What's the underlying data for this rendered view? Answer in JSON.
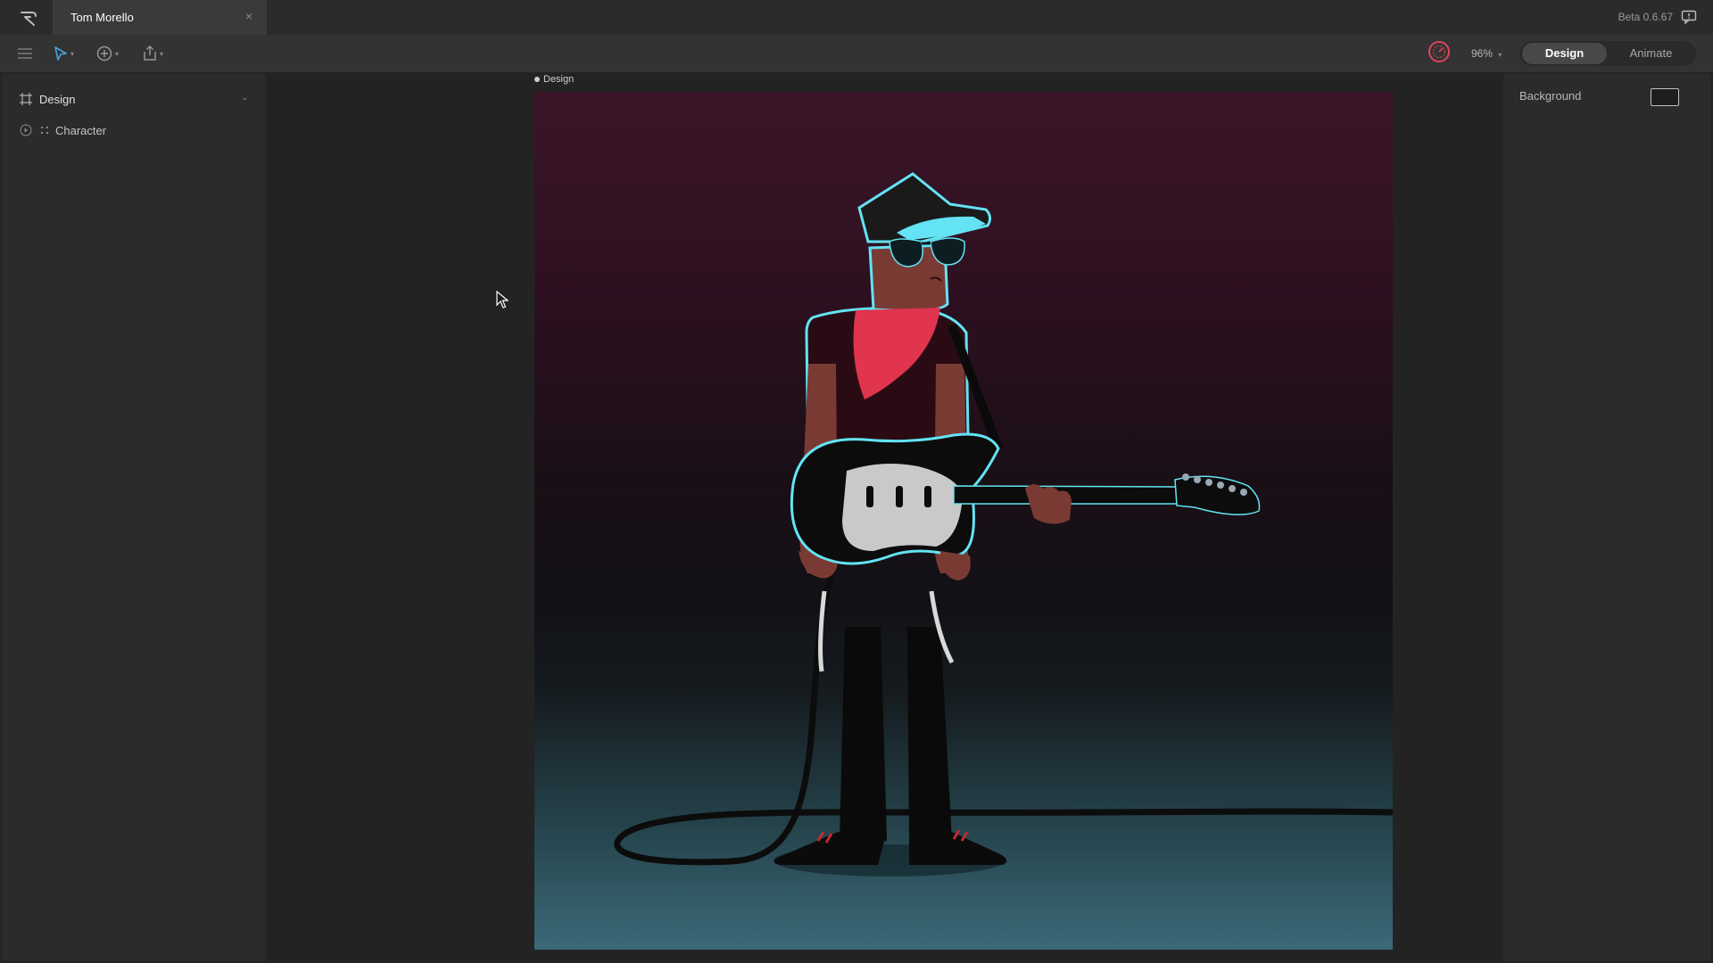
{
  "titlebar": {
    "tab_title": "Tom Morello",
    "close_glyph": "×",
    "version": "Beta 0.6.67"
  },
  "toolbar": {
    "zoom": "96%",
    "modes": {
      "design": "Design",
      "animate": "Animate"
    },
    "icons": [
      "menu-icon",
      "select-tool-icon",
      "add-icon",
      "export-icon",
      "performance-gauge-icon"
    ]
  },
  "layers": {
    "root": {
      "label": "Design",
      "icon": "artboard-icon"
    },
    "items": [
      {
        "label": "Character",
        "icon": "node-icon"
      }
    ]
  },
  "canvas": {
    "artboard_label": "Design"
  },
  "inspector": {
    "background_label": "Background"
  },
  "colors": {
    "accent_blue": "#4aa3df",
    "gauge_red": "#e0455a",
    "outline_cyan": "#63e3f3",
    "bandana_red": "#e0344f"
  }
}
